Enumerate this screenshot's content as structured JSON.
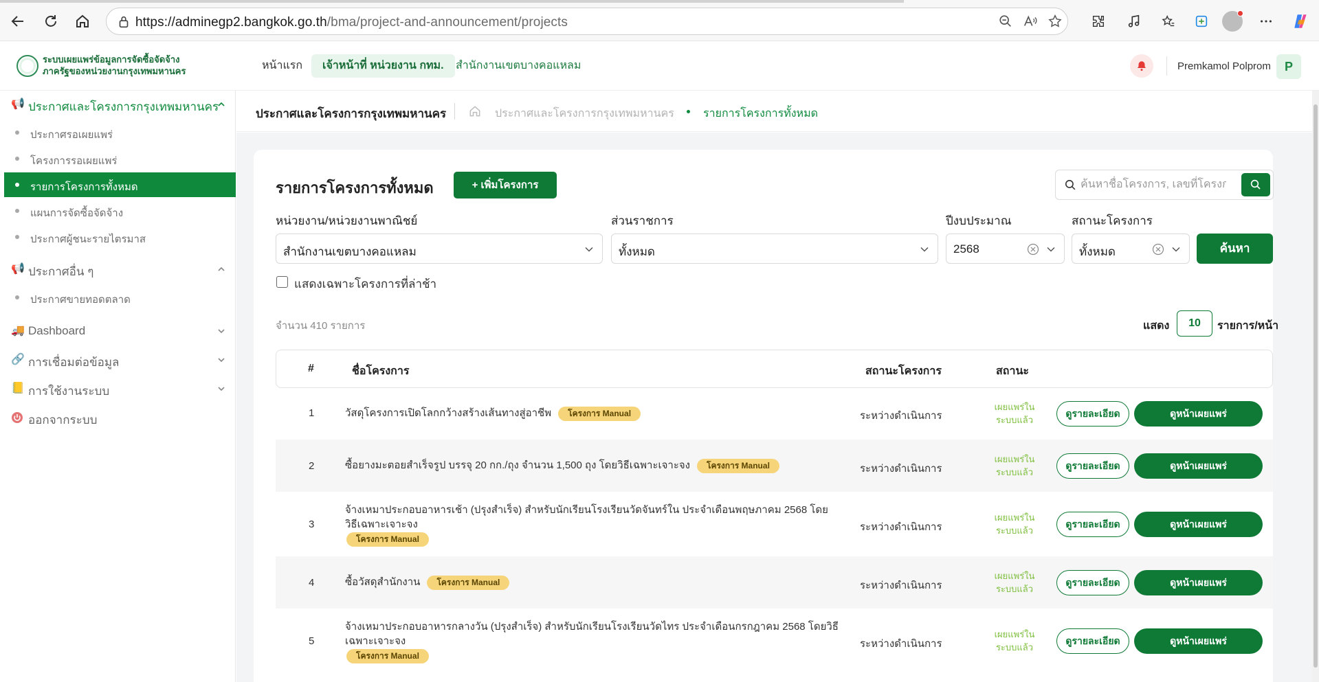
{
  "browser": {
    "url_host": "https://adminegp2.bangkok.go.th",
    "url_path": "/bma/project-and-announcement/projects"
  },
  "header": {
    "logo_line1": "ระบบเผยแพร่ข้อมูลการจัดซื้อจัดจ้าง",
    "logo_line2": "ภาครัฐของหน่วยงานกรุงเทพมหานคร",
    "nav_home": "หน้าแรก",
    "nav_role": "เจ้าหน้าที่ หน่วยงาน กทม.",
    "nav_org": "สำนักงานเขตบางคอแหลม",
    "user_name": "Premkamol Polprom",
    "user_initial": "P"
  },
  "sidebar": {
    "section1": "ประกาศและโครงการกรุงเทพมหานคร",
    "items1": [
      "ประกาศรอเผยแพร่",
      "โครงการรอเผยแพร่",
      "รายการโครงการทั้งหมด",
      "แผนการจัดซื้อจัดจ้าง",
      "ประกาศผู้ชนะรายไตรมาส"
    ],
    "section2": "ประกาศอื่น ๆ",
    "items2": [
      "ประกาศขายทอดตลาด"
    ],
    "section3": "Dashboard",
    "section4": "การเชื่อมต่อข้อมูล",
    "section5": "การใช้งานระบบ",
    "section6": "ออกจากระบบ"
  },
  "breadcrumb": {
    "title": "ประกาศและโครงการกรุงเทพมหานคร",
    "level1": "ประกาศและโครงการกรุงเทพมหานคร",
    "level2": "รายการโครงการทั้งหมด"
  },
  "main": {
    "title": "รายการโครงการทั้งหมด",
    "add_button": "+ เพิ่มโครงการ",
    "search_placeholder": "ค้นหาชื่อโครงการ, เลขที่โครงการ",
    "filters": {
      "agency_label": "หน่วยงาน/หน่วยงานพาณิชย์",
      "agency_value": "สำนักงานเขตบางคอแหลม",
      "division_label": "ส่วนราชการ",
      "division_value": "ทั้งหมด",
      "year_label": "ปีงบประมาณ",
      "year_value": "2568",
      "status_label": "สถานะโครงการ",
      "status_value": "ทั้งหมด",
      "find_button": "ค้นหา"
    },
    "late_only_label": "แสดงเฉพาะโครงการที่ล่าช้า",
    "count_text": "จำนวน  410  รายการ",
    "show_label": "แสดง",
    "page_size": "10",
    "per_page_label": "รายการ/หน้า"
  },
  "table": {
    "headers": {
      "num": "#",
      "name": "ชื่อโครงการ",
      "project_status": "สถานะโครงการ",
      "status": "สถานะ"
    },
    "badge": "โครงการ Manual",
    "detail_button": "ดูรายละเอียด",
    "view_button": "ดูหน้าเผยแพร่",
    "rows": [
      {
        "num": "1",
        "name": "วัสดุโครงการเปิดโลกกว้างสร้างเส้นทางสู่อาชีพ",
        "project_status": "ระหว่างดำเนินการ",
        "publish_status": "เผยแพร่ในระบบแล้ว"
      },
      {
        "num": "2",
        "name": "ซื้อยางมะตอยสำเร็จรูป บรรจุ 20 กก./ถุง จำนวน 1,500 ถุง โดยวิธีเฉพาะเจาะจง",
        "project_status": "ระหว่างดำเนินการ",
        "publish_status": "เผยแพร่ในระบบแล้ว"
      },
      {
        "num": "3",
        "name": "จ้างเหมาประกอบอาหารเช้า (ปรุงสำเร็จ) สำหรับนักเรียนโรงเรียนวัดจันทร์ใน ประจำเดือนพฤษภาคม 2568 โดยวิธีเฉพาะเจาะจง",
        "project_status": "ระหว่างดำเนินการ",
        "publish_status": "เผยแพร่ในระบบแล้ว"
      },
      {
        "num": "4",
        "name": "ซื้อวัสดุสำนักงาน",
        "project_status": "ระหว่างดำเนินการ",
        "publish_status": "เผยแพร่ในระบบแล้ว"
      },
      {
        "num": "5",
        "name": "จ้างเหมาประกอบอาหารกลางวัน (ปรุงสำเร็จ) สำหรับนักเรียนโรงเรียนวัดไทร ประจำเดือนกรกฎาคม 2568 โดยวิธีเฉพาะเจาะจง",
        "project_status": "ระหว่างดำเนินการ",
        "publish_status": "เผยแพร่ในระบบแล้ว"
      }
    ]
  }
}
